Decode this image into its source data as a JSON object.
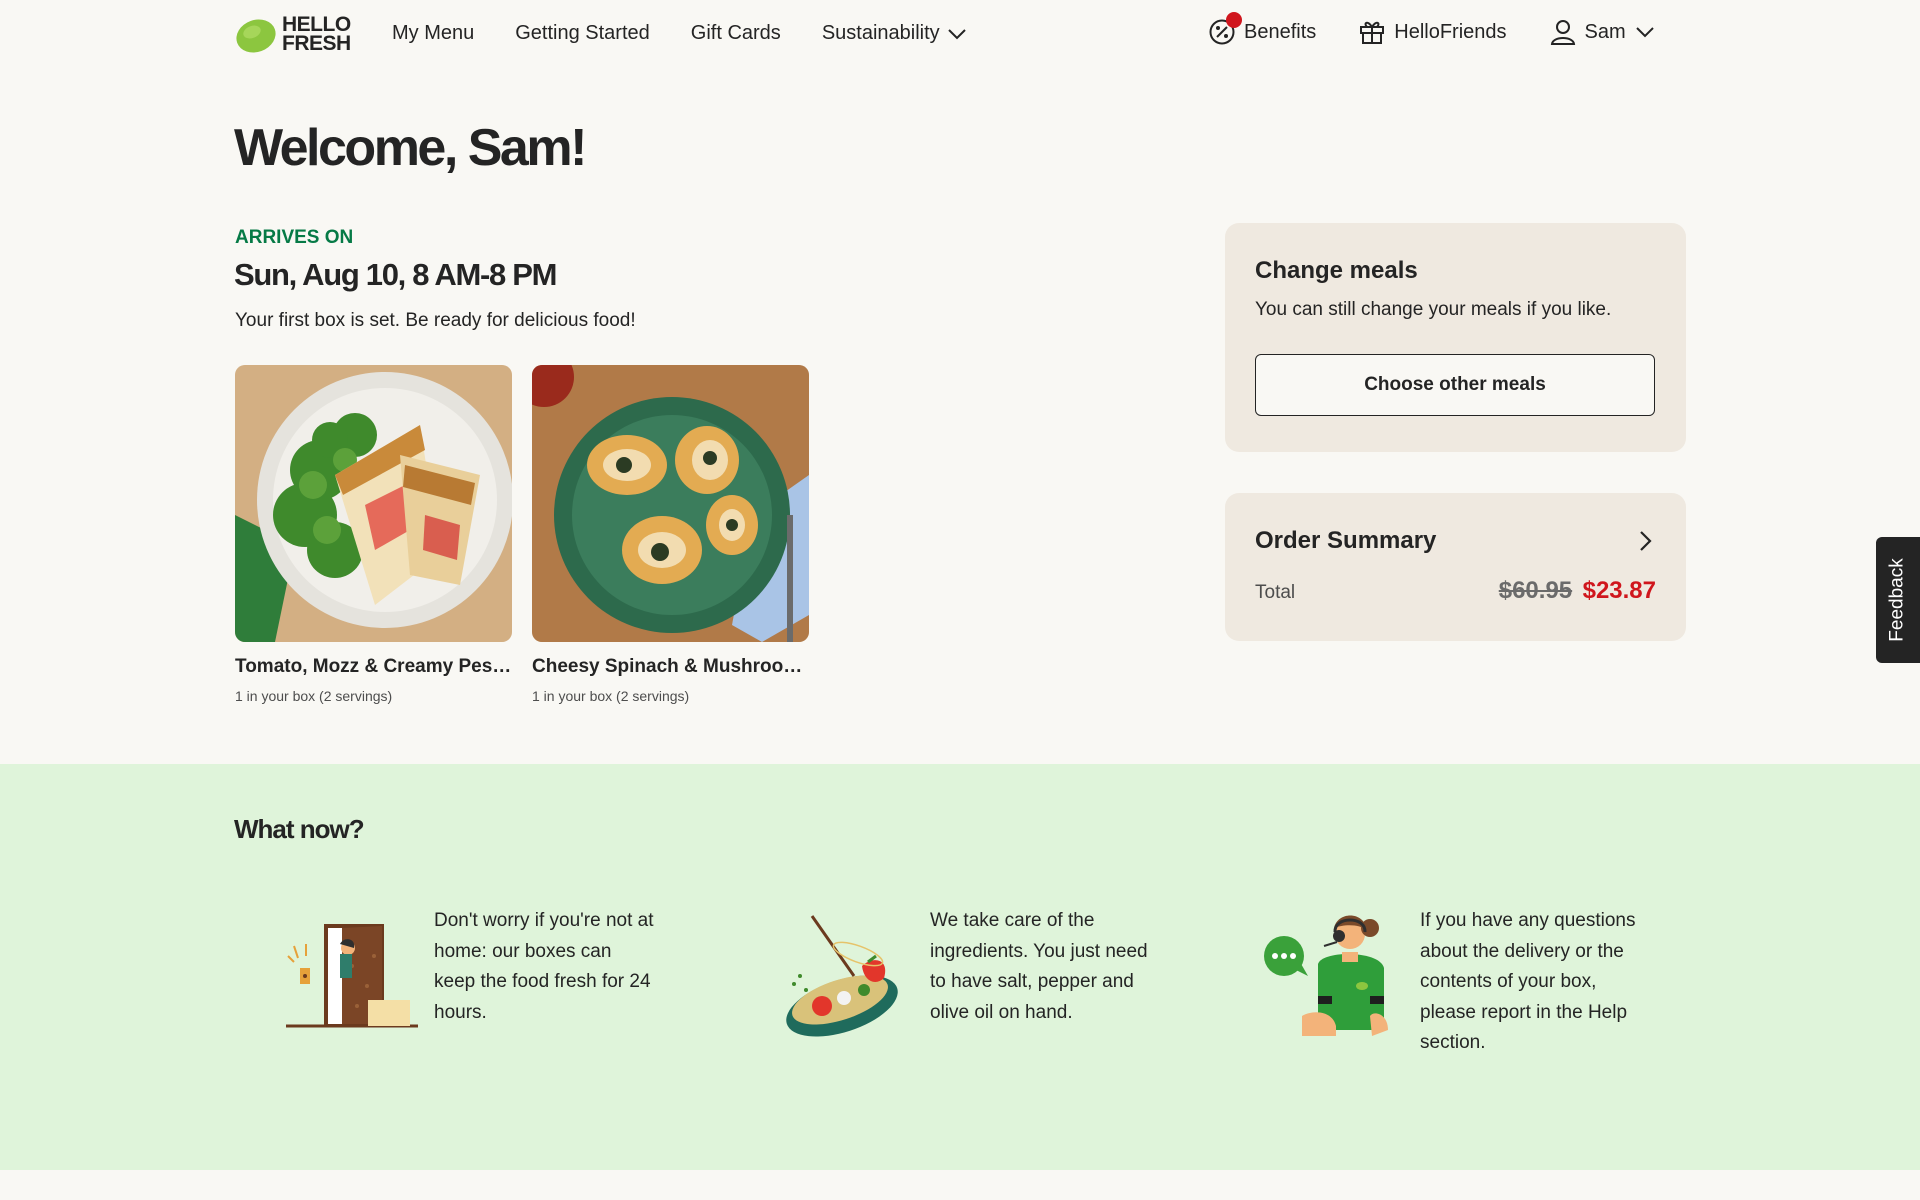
{
  "brand": {
    "logo_text_line1": "HELLO",
    "logo_text_line2": "FRESH",
    "lime_color": "#8cc63f"
  },
  "nav": {
    "items": [
      {
        "label": "My Menu"
      },
      {
        "label": "Getting Started"
      },
      {
        "label": "Gift Cards"
      },
      {
        "label": "Sustainability"
      }
    ],
    "right": {
      "benefits": "Benefits",
      "hellofriends": "HelloFriends",
      "user": "Sam"
    }
  },
  "welcome": "Welcome, Sam!",
  "delivery": {
    "label": "ARRIVES ON",
    "date": "Sun, Aug 10, 8 AM-8 PM",
    "note": "Your first box is set. Be ready for delicious food!"
  },
  "meals": [
    {
      "title": "Tomato, Mozz & Creamy Pes…",
      "subtitle": "1 in your box (2 servings)"
    },
    {
      "title": "Cheesy Spinach & Mushroo…",
      "subtitle": "1 in your box (2 servings)"
    }
  ],
  "change_meals": {
    "title": "Change meals",
    "text": "You can still change your meals if you like.",
    "button": "Choose other meals"
  },
  "order_summary": {
    "title": "Order Summary",
    "total_label": "Total",
    "old_price": "$60.95",
    "new_price": "$23.87"
  },
  "feedback": "Feedback",
  "what_now": {
    "title": "What now?",
    "tips": [
      {
        "text": "Don't worry if you're not at home: our boxes can keep the food fresh for 24 hours."
      },
      {
        "text": "We take care of the ingredients. You just need to have salt, pepper and olive oil on hand."
      },
      {
        "text": "If you have any questions about the delivery or the contents of your box, please report in the Help section."
      }
    ]
  },
  "colors": {
    "accent_green": "#067a46",
    "price_red": "#d0161d",
    "panel_bg": "#efe9e0",
    "section_green": "#dff4da"
  }
}
